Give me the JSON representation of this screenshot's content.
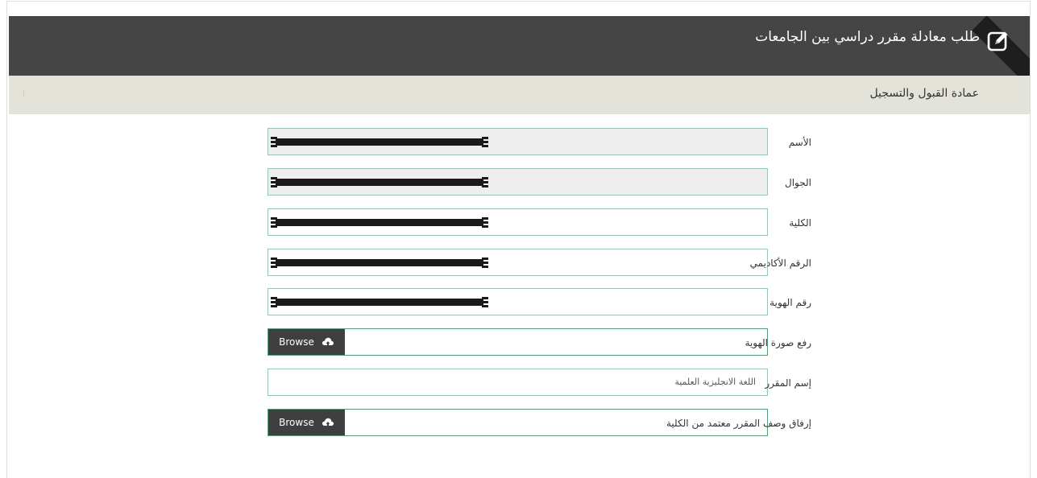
{
  "header": {
    "title": "طلب معادلة مقرر دراسي بين الجامعات",
    "icon": "edit-icon"
  },
  "subheader": {
    "title": "عمادة القبول والتسجيل"
  },
  "form": {
    "name_label": "الأسم",
    "mobile_label": "الجوال",
    "college_label": "الكلية",
    "academic_number_label": "الرقم الأكاديمي",
    "id_number_label": "رقم الهوية",
    "id_image_label": "رفع صورة الهوية",
    "course_name_label": "إسم المقرر",
    "course_name_value": "اللغة الانجليزية العلمية",
    "course_desc_label": "إرفاق وصف المقرر معتمد من الكلية",
    "browse_label": "Browse"
  },
  "colors": {
    "header_bg": "#454545",
    "subheader_bg": "#e3e3d9",
    "field_border": "#7fcfc9",
    "file_border": "#2db36b",
    "button_bg": "#3f3f3f"
  }
}
